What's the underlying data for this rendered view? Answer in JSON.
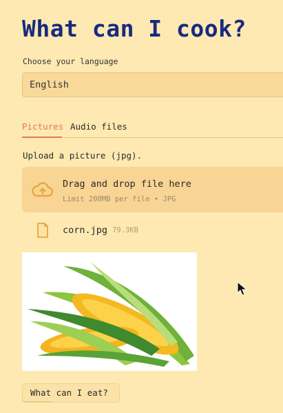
{
  "page": {
    "title": "What can I cook?"
  },
  "language": {
    "label": "Choose your language",
    "selected": "English"
  },
  "tabs": [
    {
      "label": "Pictures",
      "active": true
    },
    {
      "label": "Audio files",
      "active": false
    }
  ],
  "upload": {
    "label": "Upload a picture (jpg).",
    "dropzone_text": "Drag and drop file here",
    "dropzone_hint": "Limit 200MB per file • JPG",
    "icon": "cloud-upload-icon"
  },
  "file": {
    "name": "corn.jpg",
    "size": "79.3KB",
    "icon": "file-icon"
  },
  "preview": {
    "subject": "corn cobs"
  },
  "action": {
    "label": "What can I eat?"
  },
  "colors": {
    "background": "#fde9b1",
    "title": "#182a80",
    "accent": "#e07a52",
    "input": "#f8d99a",
    "dropzone": "#f8d594",
    "icon": "#e8a43a"
  }
}
